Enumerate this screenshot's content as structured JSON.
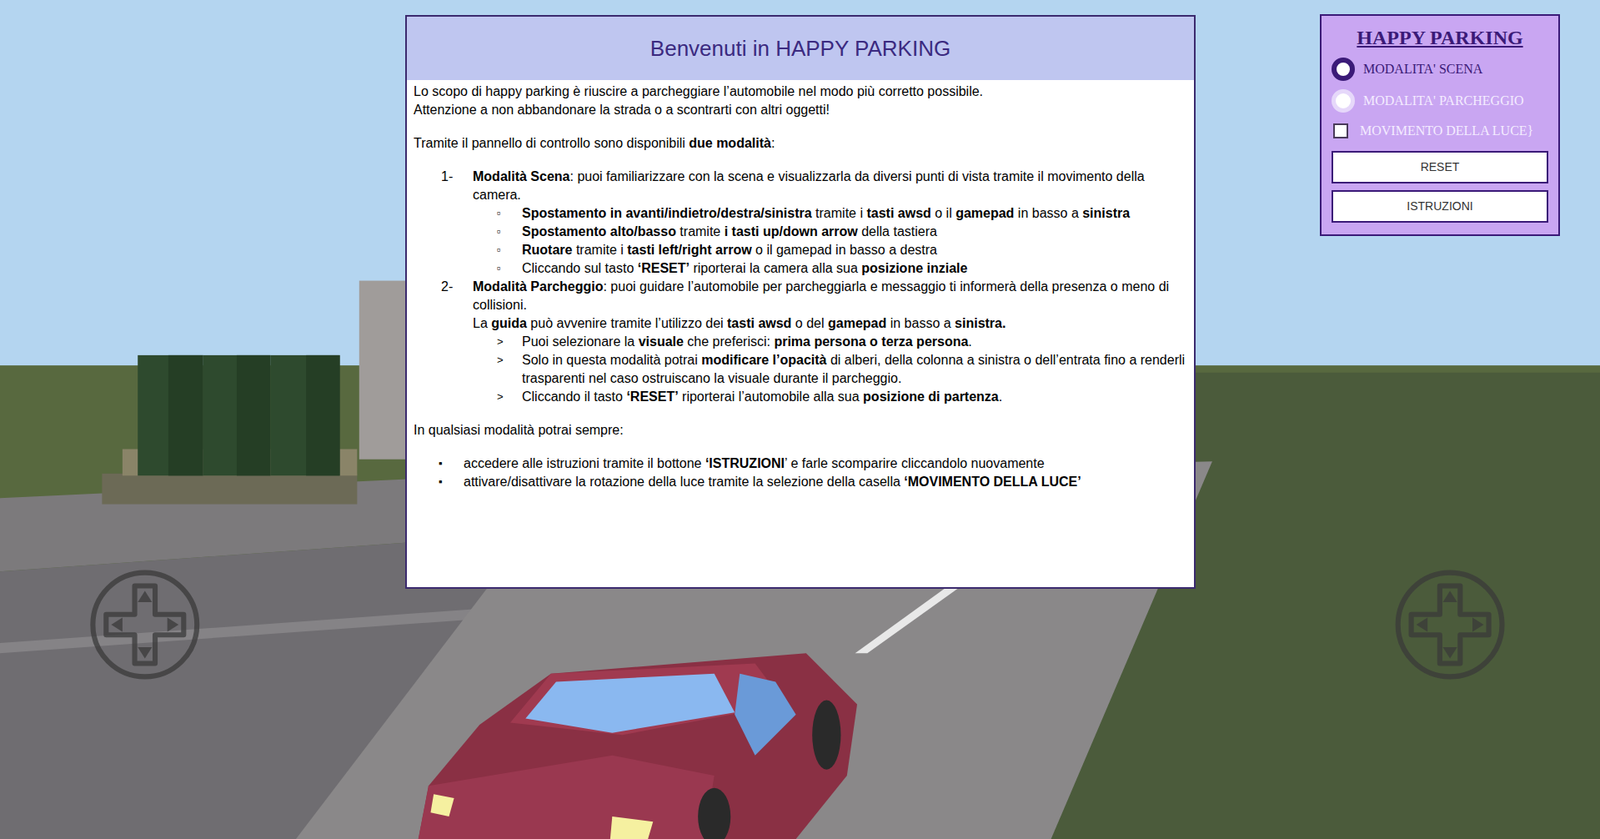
{
  "modal": {
    "title": "Benvenuti in HAPPY PARKING",
    "intro": [
      "Lo scopo di happy parking è riuscire a parcheggiare l’automobile nel modo più corretto possibile.",
      "Attenzione a non abbandonare la strada o a scontrarti con altri oggetti!"
    ],
    "modes_intro": [
      [
        "Tramite il pannello di controllo sono disponibili ",
        false
      ],
      [
        "due modalità",
        true
      ],
      [
        ":",
        false
      ]
    ],
    "modes": [
      {
        "marker": "1-",
        "text": [
          [
            "Modalità Scena",
            true
          ],
          [
            ": puoi familiarizzare con la scena e visualizzarla da diversi punti di vista tramite il movimento della camera.",
            false
          ]
        ],
        "extra": [],
        "items": [
          {
            "marker": "▫",
            "text": [
              [
                "Spostamento in avanti/indietro/destra/sinistra",
                true
              ],
              [
                " tramite i ",
                false
              ],
              [
                "tasti awsd",
                true
              ],
              [
                " o il ",
                false
              ],
              [
                "gamepad",
                true
              ],
              [
                " in basso a ",
                false
              ],
              [
                "sinistra",
                true
              ]
            ]
          },
          {
            "marker": "▫",
            "text": [
              [
                "Spostamento alto/basso",
                true
              ],
              [
                " tramite ",
                false
              ],
              [
                "i tasti up/down arrow",
                true
              ],
              [
                " della tastiera",
                false
              ]
            ]
          },
          {
            "marker": "▫",
            "text": [
              [
                "Ruotare",
                true
              ],
              [
                " tramite i ",
                false
              ],
              [
                "tasti left/right arrow",
                true
              ],
              [
                " o il gamepad in basso a destra",
                false
              ]
            ]
          },
          {
            "marker": "▫",
            "text": [
              [
                "Cliccando sul tasto ",
                false
              ],
              [
                "‘RESET’",
                true
              ],
              [
                " riporterai la camera alla sua ",
                false
              ],
              [
                "posizione inziale",
                true
              ]
            ]
          }
        ]
      },
      {
        "marker": "2-",
        "text": [
          [
            "Modalità Parcheggio",
            true
          ],
          [
            ": puoi guidare l’automobile per parcheggiarla e messaggio ti informerà della presenza o meno di collisioni.",
            false
          ]
        ],
        "extra": [
          [
            "La ",
            false
          ],
          [
            "guida",
            true
          ],
          [
            " può avvenire tramite l’utilizzo dei ",
            false
          ],
          [
            "tasti awsd",
            true
          ],
          [
            " o del ",
            false
          ],
          [
            "gamepad",
            true
          ],
          [
            " in basso a ",
            false
          ],
          [
            "sinistra.",
            true
          ]
        ],
        "items": [
          {
            "marker": ">",
            "text": [
              [
                "Puoi selezionare la ",
                false
              ],
              [
                "visuale",
                true
              ],
              [
                " che preferisci: ",
                false
              ],
              [
                "prima persona o terza persona",
                true
              ],
              [
                ".",
                false
              ]
            ]
          },
          {
            "marker": ">",
            "text": [
              [
                "Solo in questa modalità potrai ",
                false
              ],
              [
                "modificare l’opacità",
                true
              ],
              [
                " di alberi, della colonna a sinistra o dell’entrata fino a renderli trasparenti nel caso ostruiscano la visuale durante il parcheggio.",
                false
              ]
            ]
          },
          {
            "marker": ">",
            "text": [
              [
                "Cliccando il tasto ",
                false
              ],
              [
                "‘RESET’",
                true
              ],
              [
                " riporterai l’automobile alla sua ",
                false
              ],
              [
                "posizione di partenza",
                true
              ],
              [
                ".",
                false
              ]
            ]
          }
        ]
      }
    ],
    "always_intro": "In qualsiasi modalità potrai sempre:",
    "always": [
      {
        "marker": "▪",
        "text": [
          [
            "accedere alle istruzioni tramite il bottone ",
            false
          ],
          [
            "‘ISTRUZIONI",
            true
          ],
          [
            "’ e farle scomparire cliccandolo nuovamente",
            false
          ]
        ]
      },
      {
        "marker": "▪",
        "text": [
          [
            "attivare/disattivare la rotazione della luce tramite la selezione della casella ",
            false
          ],
          [
            "‘MOVIMENTO DELLA LUCE’",
            true
          ]
        ]
      }
    ]
  },
  "panel": {
    "title": "HAPPY PARKING",
    "radios": [
      {
        "label": "MODALITA' SCENA",
        "selected": true
      },
      {
        "label": "MODALITA' PARCHEGGIO",
        "selected": false
      }
    ],
    "checkbox": {
      "label": "MOVIMENTO DELLA LUCE",
      "checked": false
    },
    "buttons": [
      "RESET",
      "ISTRUZIONI"
    ]
  }
}
